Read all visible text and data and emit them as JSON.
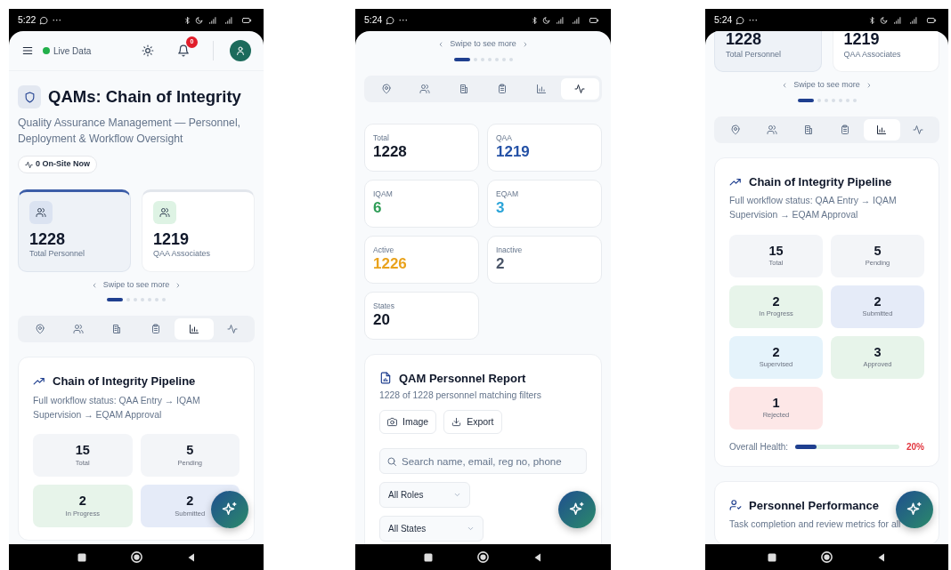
{
  "phones": [
    {
      "status_bar": {
        "time": "5:22",
        "more": "···"
      },
      "sections": [
        {
          "kind": "topbar",
          "live_label": "Live Data",
          "notification_count": "0"
        },
        {
          "kind": "header",
          "title": "QAMs: Chain of Integrity",
          "subtitle": "Quality Assurance Management — Personnel, Deployment & Workflow Oversight",
          "badge": "0 On-Site Now"
        },
        {
          "kind": "stat_cards",
          "clipped_top": false,
          "cards": [
            {
              "value": "1228",
              "label": "Total Personnel",
              "selected": true,
              "color": "#dbe3f1"
            },
            {
              "value": "1219",
              "label": "QAA Associates",
              "selected": false,
              "color": "#def3e4"
            }
          ]
        },
        {
          "kind": "swipe",
          "hint": "Swipe to see more",
          "dots": [
            {
              "selected": true
            },
            {
              "selected": false
            },
            {
              "selected": false
            },
            {
              "selected": false
            },
            {
              "selected": false
            },
            {
              "selected": false
            },
            {
              "selected": false
            }
          ]
        },
        {
          "kind": "icon_tabs",
          "tabs": [
            {
              "selected": false
            },
            {
              "selected": false
            },
            {
              "selected": false
            },
            {
              "selected": false
            },
            {
              "selected": true
            },
            {
              "selected": false
            }
          ]
        },
        {
          "kind": "pipeline",
          "title": "Chain of Integrity Pipeline",
          "description": "Full workflow status: QAA Entry → IQAM Supervision → EQAM Approval",
          "tiles": [
            {
              "value": "15",
              "label": "Total",
              "color": "#f3f5f8"
            },
            {
              "value": "5",
              "label": "Pending",
              "color": "#f3f5f8"
            },
            {
              "value": "2",
              "label": "In Progress",
              "color": "#e7f4ea"
            },
            {
              "value": "2",
              "label": "Submitted",
              "color": "#e5ebf8"
            }
          ]
        }
      ]
    },
    {
      "status_bar": {
        "time": "5:24",
        "more": "···"
      },
      "sections": [
        {
          "kind": "swipe",
          "hint": "Swipe to see more",
          "dots": [
            {
              "selected": true
            },
            {
              "selected": false
            },
            {
              "selected": false
            },
            {
              "selected": false
            },
            {
              "selected": false
            },
            {
              "selected": false
            },
            {
              "selected": false
            }
          ]
        },
        {
          "kind": "icon_tabs",
          "tabs": [
            {
              "selected": false
            },
            {
              "selected": false
            },
            {
              "selected": false
            },
            {
              "selected": false
            },
            {
              "selected": false
            },
            {
              "selected": true
            }
          ]
        },
        {
          "kind": "metrics",
          "items": [
            {
              "label": "Total",
              "value": "1228",
              "color": "#111827"
            },
            {
              "label": "QAA",
              "value": "1219",
              "color": "#2451a6"
            },
            {
              "label": "IQAM",
              "value": "6",
              "color": "#2f9d57"
            },
            {
              "label": "EQAM",
              "value": "3",
              "color": "#2ba4d8"
            },
            {
              "label": "Active",
              "value": "1226",
              "color": "#e9a21b"
            },
            {
              "label": "Inactive",
              "value": "2",
              "color": "#4a5568"
            },
            {
              "label": "States",
              "value": "20",
              "color": "#111827"
            }
          ]
        },
        {
          "kind": "report",
          "title": "QAM Personnel Report",
          "summary": "1228 of 1228 personnel matching filters",
          "buttons": [
            "Image",
            "Export"
          ],
          "search": {
            "placeholder": "Search name, email, reg no, phone"
          },
          "filters": [
            "All Roles",
            "All States"
          ]
        }
      ]
    },
    {
      "status_bar": {
        "time": "5:24",
        "more": "···"
      },
      "sections": [
        {
          "kind": "stat_cards",
          "clipped_top": true,
          "cards": [
            {
              "value": "1228",
              "label": "Total Personnel",
              "selected": true
            },
            {
              "value": "1219",
              "label": "QAA Associates",
              "selected": false
            }
          ]
        },
        {
          "kind": "swipe",
          "hint": "Swipe to see more",
          "dots": [
            {
              "selected": true
            },
            {
              "selected": false
            },
            {
              "selected": false
            },
            {
              "selected": false
            },
            {
              "selected": false
            },
            {
              "selected": false
            },
            {
              "selected": false
            }
          ]
        },
        {
          "kind": "icon_tabs",
          "tabs": [
            {
              "selected": false
            },
            {
              "selected": false
            },
            {
              "selected": false
            },
            {
              "selected": false
            },
            {
              "selected": true
            },
            {
              "selected": false
            }
          ]
        },
        {
          "kind": "pipeline",
          "title": "Chain of Integrity Pipeline",
          "description": "Full workflow status: QAA Entry → IQAM Supervision → EQAM Approval",
          "tiles": [
            {
              "value": "15",
              "label": "Total",
              "color": "#f3f5f8"
            },
            {
              "value": "5",
              "label": "Pending",
              "color": "#f3f5f8"
            },
            {
              "value": "2",
              "label": "In Progress",
              "color": "#e7f4ea"
            },
            {
              "value": "2",
              "label": "Submitted",
              "color": "#e5ebf8"
            },
            {
              "value": "2",
              "label": "Supervised",
              "color": "#e5f3fb"
            },
            {
              "value": "3",
              "label": "Approved",
              "color": "#e7f4ea"
            },
            {
              "value": "1",
              "label": "Rejected",
              "color": "#fde7e7"
            }
          ],
          "health": {
            "label": "Overall Health:",
            "level": 0.2,
            "reading": "20%"
          }
        },
        {
          "kind": "performance",
          "title": "Personnel Performance",
          "description": "Task completion and review metrics for all"
        }
      ]
    }
  ]
}
